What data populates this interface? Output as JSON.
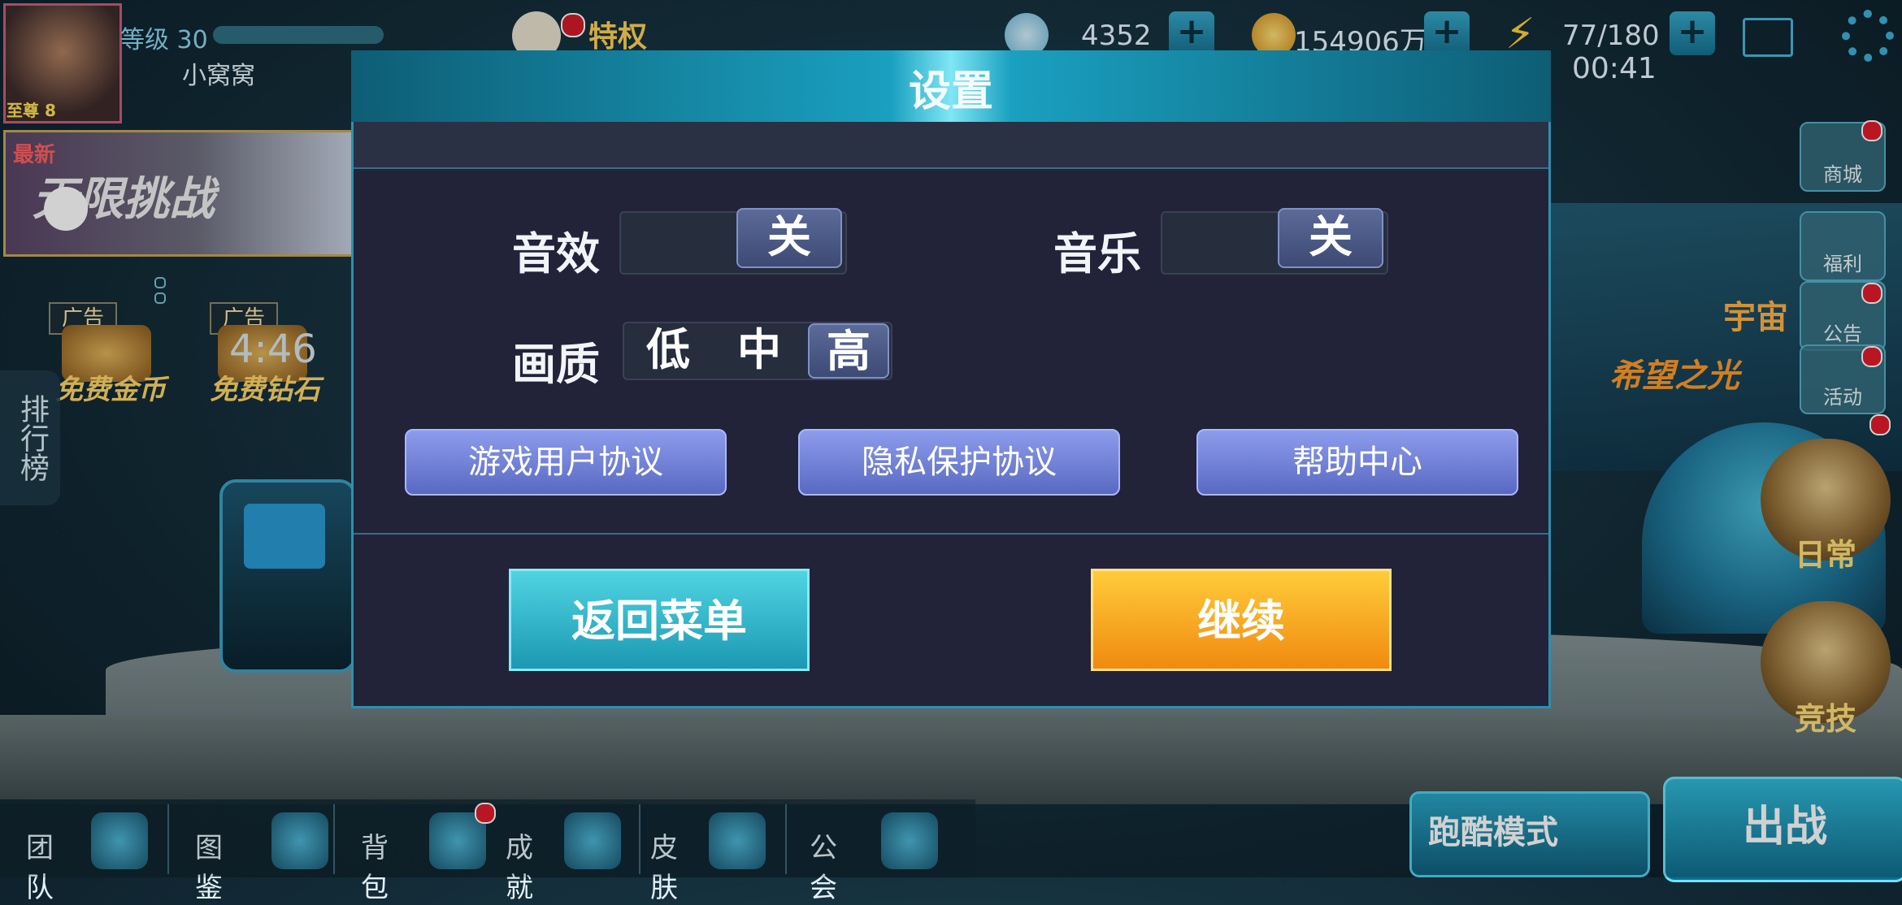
{
  "hud": {
    "level_label": "等级",
    "level_value": "30",
    "player_name": "小窝窝",
    "privilege": "特权",
    "avatar_rank": "8",
    "gems": "4352",
    "gold": "154906万",
    "energy": "77/180",
    "timer": "00:41"
  },
  "left": {
    "challenge_new": "最新",
    "challenge_title": "无限挑战",
    "ad_tag": "广告",
    "ad1_label": "免费金币",
    "ad2_label": "免费钻石",
    "ad2_timer": "4:46",
    "rank_tab": "排行榜"
  },
  "right": {
    "shop": "商城",
    "welfare": "福利",
    "notice": "公告",
    "activity": "活动",
    "ultraman": "希望之光",
    "cosmic": "宇宙",
    "daily": "日常",
    "arena": "竞技"
  },
  "bottom": {
    "team": "团队",
    "codex": "图鉴",
    "bag": "背包",
    "achievement": "成就",
    "skin": "皮肤",
    "guild": "公会",
    "parkour": "跑酷模式",
    "fight": "出战"
  },
  "settings": {
    "title": "设置",
    "sound_label": "音效",
    "sound_state": "关",
    "music_label": "音乐",
    "music_state": "关",
    "quality_label": "画质",
    "quality_options": [
      "低",
      "中",
      "高"
    ],
    "quality_selected": "高",
    "user_agreement": "游戏用户协议",
    "privacy": "隐私保护协议",
    "help": "帮助中心",
    "back_to_menu": "返回菜单",
    "continue": "继续"
  },
  "colors": {
    "dialog_bg": "#222338",
    "accent": "#2c8fb0",
    "link_button": "#7382d8",
    "back_button": "#36b6cc",
    "continue_button": "#f6a420"
  }
}
